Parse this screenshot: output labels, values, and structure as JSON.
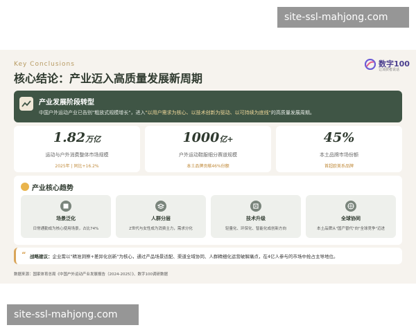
{
  "watermark": {
    "top": "site-ssl-mahjong.com",
    "bottom": "site-ssl-mahjong.com"
  },
  "header": {
    "kicker": "Key Conclusions",
    "title": "核心结论：产业迈入高质量发展新周期",
    "logo_text": "数字100",
    "logo_sub": "让消费者说话"
  },
  "phase": {
    "title": "产业发展阶段转型",
    "desc_pre": "中国户外运动产业已告别\"粗放式规模增长\"，进入",
    "desc_highlight": "\"以用户需求为核心、以技术创新为驱动、以可持续为底线\"",
    "desc_post": "的高质量发展周期。"
  },
  "stats": [
    {
      "value": "1.82",
      "unit": "万亿",
      "label": "运动与户外消费整体市场规模",
      "note": "2025年 | 同比+16.2%"
    },
    {
      "value": "1000",
      "unit": "亿+",
      "label": "户外运动鞋服细分赛道规模",
      "note": "本土品牌贡献46%份额"
    },
    {
      "value": "45%",
      "unit": "",
      "label": "本土品牌市场份额",
      "note": "首超欧美系品牌"
    }
  ],
  "trends": {
    "title": "产业核心趋势",
    "items": [
      {
        "title": "场景泛化",
        "desc": "日常通勤成为核心使用场景，占比74%"
      },
      {
        "title": "人群分层",
        "desc": "Z世代与女性成为消费主力，需求分化"
      },
      {
        "title": "技术升级",
        "desc": "轻量化、环保化、智能化成创新方向"
      },
      {
        "title": "全球协同",
        "desc": "本土品牌从\"国产替代\"向\"全球竞争\"迈进"
      }
    ]
  },
  "strategy": {
    "quote": "“",
    "label": "战略建议：",
    "text": "企业需以\"精准洞察+差异化创新\"为核心，通过产品场景适配、渠道全域协同、人群精细化运营破解痛点，在4亿人参与的市场中抢占主导地位。"
  },
  "source": "数据来源：国家体育总局《中国户外运动产业发展报告（2024-2025）》、数字100调研数据",
  "colors": {
    "banner": "#3f5545",
    "accent": "#d9a55a",
    "background": "#f6f3ee"
  },
  "icons": {
    "phase": "trend-chart-icon",
    "trends": "lightbulb-icon",
    "trend_items": [
      "building-icon",
      "layers-icon",
      "chip-icon",
      "globe-icon"
    ],
    "logo": "logo-mark-icon"
  }
}
